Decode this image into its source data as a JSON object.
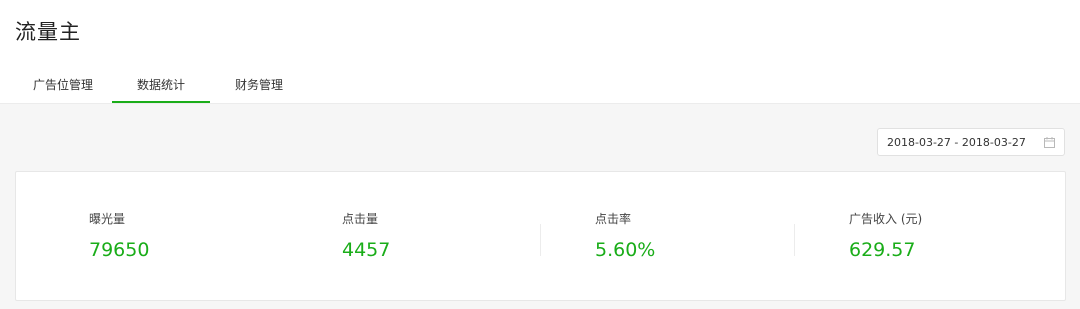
{
  "app": {
    "title": "流量主"
  },
  "tabs": [
    {
      "label": "广告位管理",
      "active": false
    },
    {
      "label": "数据统计",
      "active": true
    },
    {
      "label": "财务管理",
      "active": false
    }
  ],
  "date_range": {
    "value": "2018-03-27 - 2018-03-27",
    "icon": "calendar-icon"
  },
  "stats": [
    {
      "label": "曝光量",
      "value": "79650"
    },
    {
      "label": "点击量",
      "value": "4457"
    },
    {
      "label": "点击率",
      "value": "5.60%"
    },
    {
      "label": "广告收入 (元)",
      "value": "629.57"
    }
  ],
  "colors": {
    "accent": "#1aad19",
    "page_bg": "#f6f6f6",
    "card_bg": "#ffffff"
  }
}
